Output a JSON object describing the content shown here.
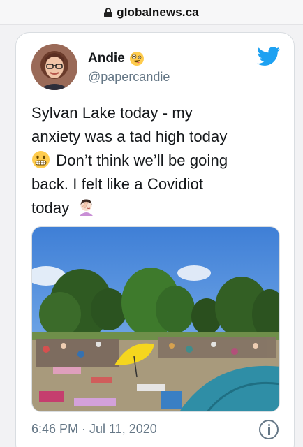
{
  "browser": {
    "domain": "globalnews.ca",
    "lock_icon": "lock-icon"
  },
  "tweet": {
    "author_name": "Andie",
    "author_emoji": "zany-face-emoji",
    "handle": "@papercandie",
    "platform_icon": "twitter-bird-icon",
    "text_line1": "Sylvan Lake today - my",
    "text_line2": "anxiety was a tad high today",
    "text_line3_after_emoji": " Don’t think we’ll be going",
    "text_line4": "back.  I felt like a Covidiot",
    "text_line5": "today",
    "emoji_grimace": "grimacing-face-emoji",
    "emoji_facepalm": "woman-facepalming-emoji",
    "image_alt": "Crowded beach at Sylvan Lake with trees and a yellow umbrella",
    "timestamp": "6:46 PM · Jul 11, 2020",
    "info_icon": "info-icon"
  },
  "colors": {
    "twitter_blue": "#1da1f2",
    "meta_gray": "#657786",
    "text": "#14171a"
  }
}
